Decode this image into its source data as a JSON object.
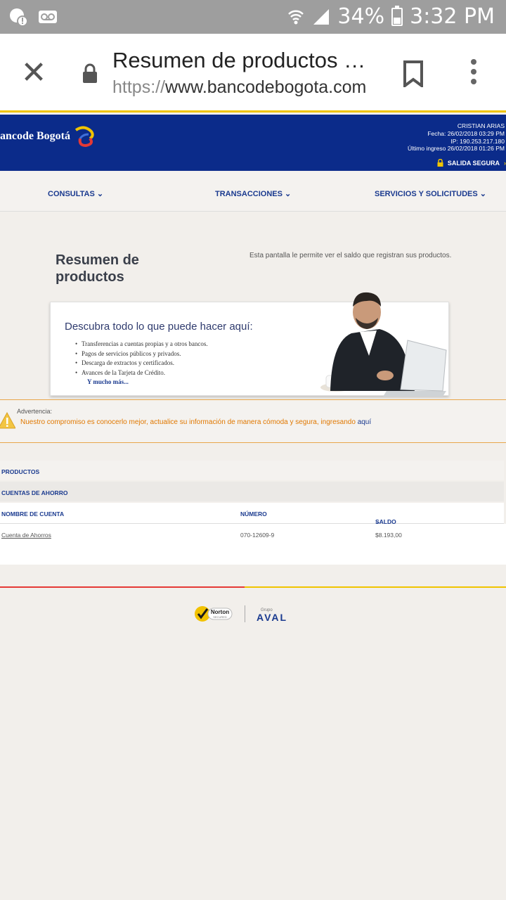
{
  "status_bar": {
    "battery": "34%",
    "time": "3:32 PM"
  },
  "browser": {
    "title": "Resumen de productos …",
    "url_scheme": "https://",
    "url_host": "www.bancodebogota.com"
  },
  "bank": {
    "logo_text": "ancode Bogotá",
    "user_name": "CRISTIAN  ARIAS",
    "date_line": "Fecha: 26/02/2018 03:29 PM",
    "ip_line": "IP: 190.253.217.180",
    "last_login": "Último ingreso 26/02/2018 01:26 PM",
    "exit_label": "SALIDA SEGURA"
  },
  "nav": {
    "items": [
      {
        "label": "CONSULTAS"
      },
      {
        "label": "TRANSACCIONES"
      },
      {
        "label": "SERVICIOS Y SOLICITUDES"
      }
    ]
  },
  "page": {
    "title": "Resumen de productos",
    "description": "Esta pantalla le permite ver el saldo que registran sus productos."
  },
  "banner": {
    "title": "Descubra todo lo que puede hacer aquí:",
    "items": [
      "Transferencias a cuentas propias y a otros bancos.",
      "Pagos de servicios públicos y privados.",
      "Descarga de extractos y certificados.",
      "Avances de la Tarjeta de Crédito."
    ],
    "more": "Y mucho más..."
  },
  "warning": {
    "label": "Advertencia:",
    "text": "Nuestro compromiso es conocerlo mejor, actualice su información de manera cómoda y segura, ingresando",
    "link": "aquí"
  },
  "table": {
    "section": "PRODUCTOS",
    "subsection": "CUENTAS DE AHORRO",
    "columns": [
      "NOMBRE DE CUENTA",
      "NÚMERO",
      "SALDO"
    ],
    "rows": [
      {
        "name": "Cuenta de Ahorros",
        "number": "070-12609-9",
        "balance": "$8.193,00"
      }
    ]
  },
  "footer": {
    "norton": "Norton",
    "norton_sub": "SECURED",
    "aval_small": "Grupo",
    "aval": "AVAL"
  },
  "colors": {
    "brand_blue": "#0b2b8a",
    "accent_yellow": "#f0c400",
    "warning_orange": "#e07800",
    "footer_red": "#e53935"
  }
}
